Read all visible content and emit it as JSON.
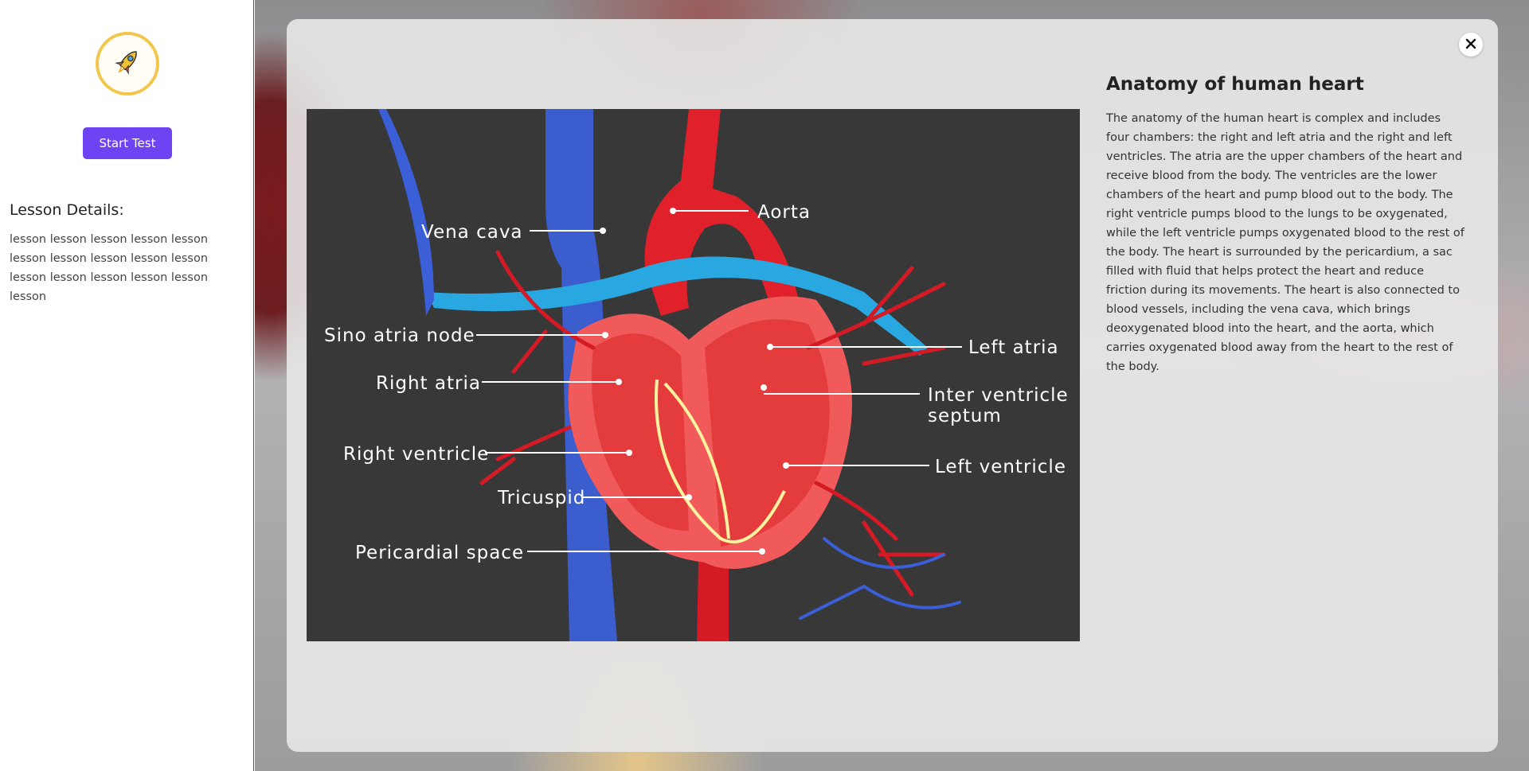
{
  "sidebar": {
    "logo_icon": "rocket-icon",
    "start_test_label": "Start Test",
    "lesson_details_title": "Lesson Details:",
    "lesson_details_text": "lesson lesson lesson lesson lesson lesson lesson lesson lesson lesson lesson lesson lesson lesson lesson lesson"
  },
  "modal": {
    "close_icon": "close-icon",
    "title": "Anatomy of human heart",
    "description": "The anatomy of the human heart is complex and includes four chambers: the right and left atria and the right and left ventricles. The atria are the upper chambers of the heart and receive blood from the body. The ventricles are the lower chambers of the heart and pump blood out to the body. The right ventricle pumps blood to the lungs to be oxygenated, while the left ventricle pumps oxygenated blood to the rest of the body. The heart is surrounded by the pericardium, a sac filled with fluid that helps protect the heart and reduce friction during its movements. The heart is also connected to blood vessels, including the vena cava, which brings deoxygenated blood into the heart, and the aorta, which carries oxygenated blood away from the heart to the rest of the body.",
    "diagram_labels": {
      "aorta": "Aorta",
      "vena_cava": "Vena cava",
      "sino_atria_node": "Sino atria node",
      "right_atria": "Right atria",
      "right_ventricle": "Right ventricle",
      "tricuspid": "Tricuspid",
      "pericardial_space": "Pericardial space",
      "left_atria": "Left atria",
      "inter_ventricle_septum_line1": "Inter ventricle",
      "inter_ventricle_septum_line2": "septum",
      "left_ventricle": "Left ventricle"
    }
  },
  "colors": {
    "accent": "#6e43f2",
    "logo_ring": "#f2c64b",
    "diagram_bg": "#383838",
    "artery": "#e0202a",
    "vein": "#3b5fd6"
  }
}
